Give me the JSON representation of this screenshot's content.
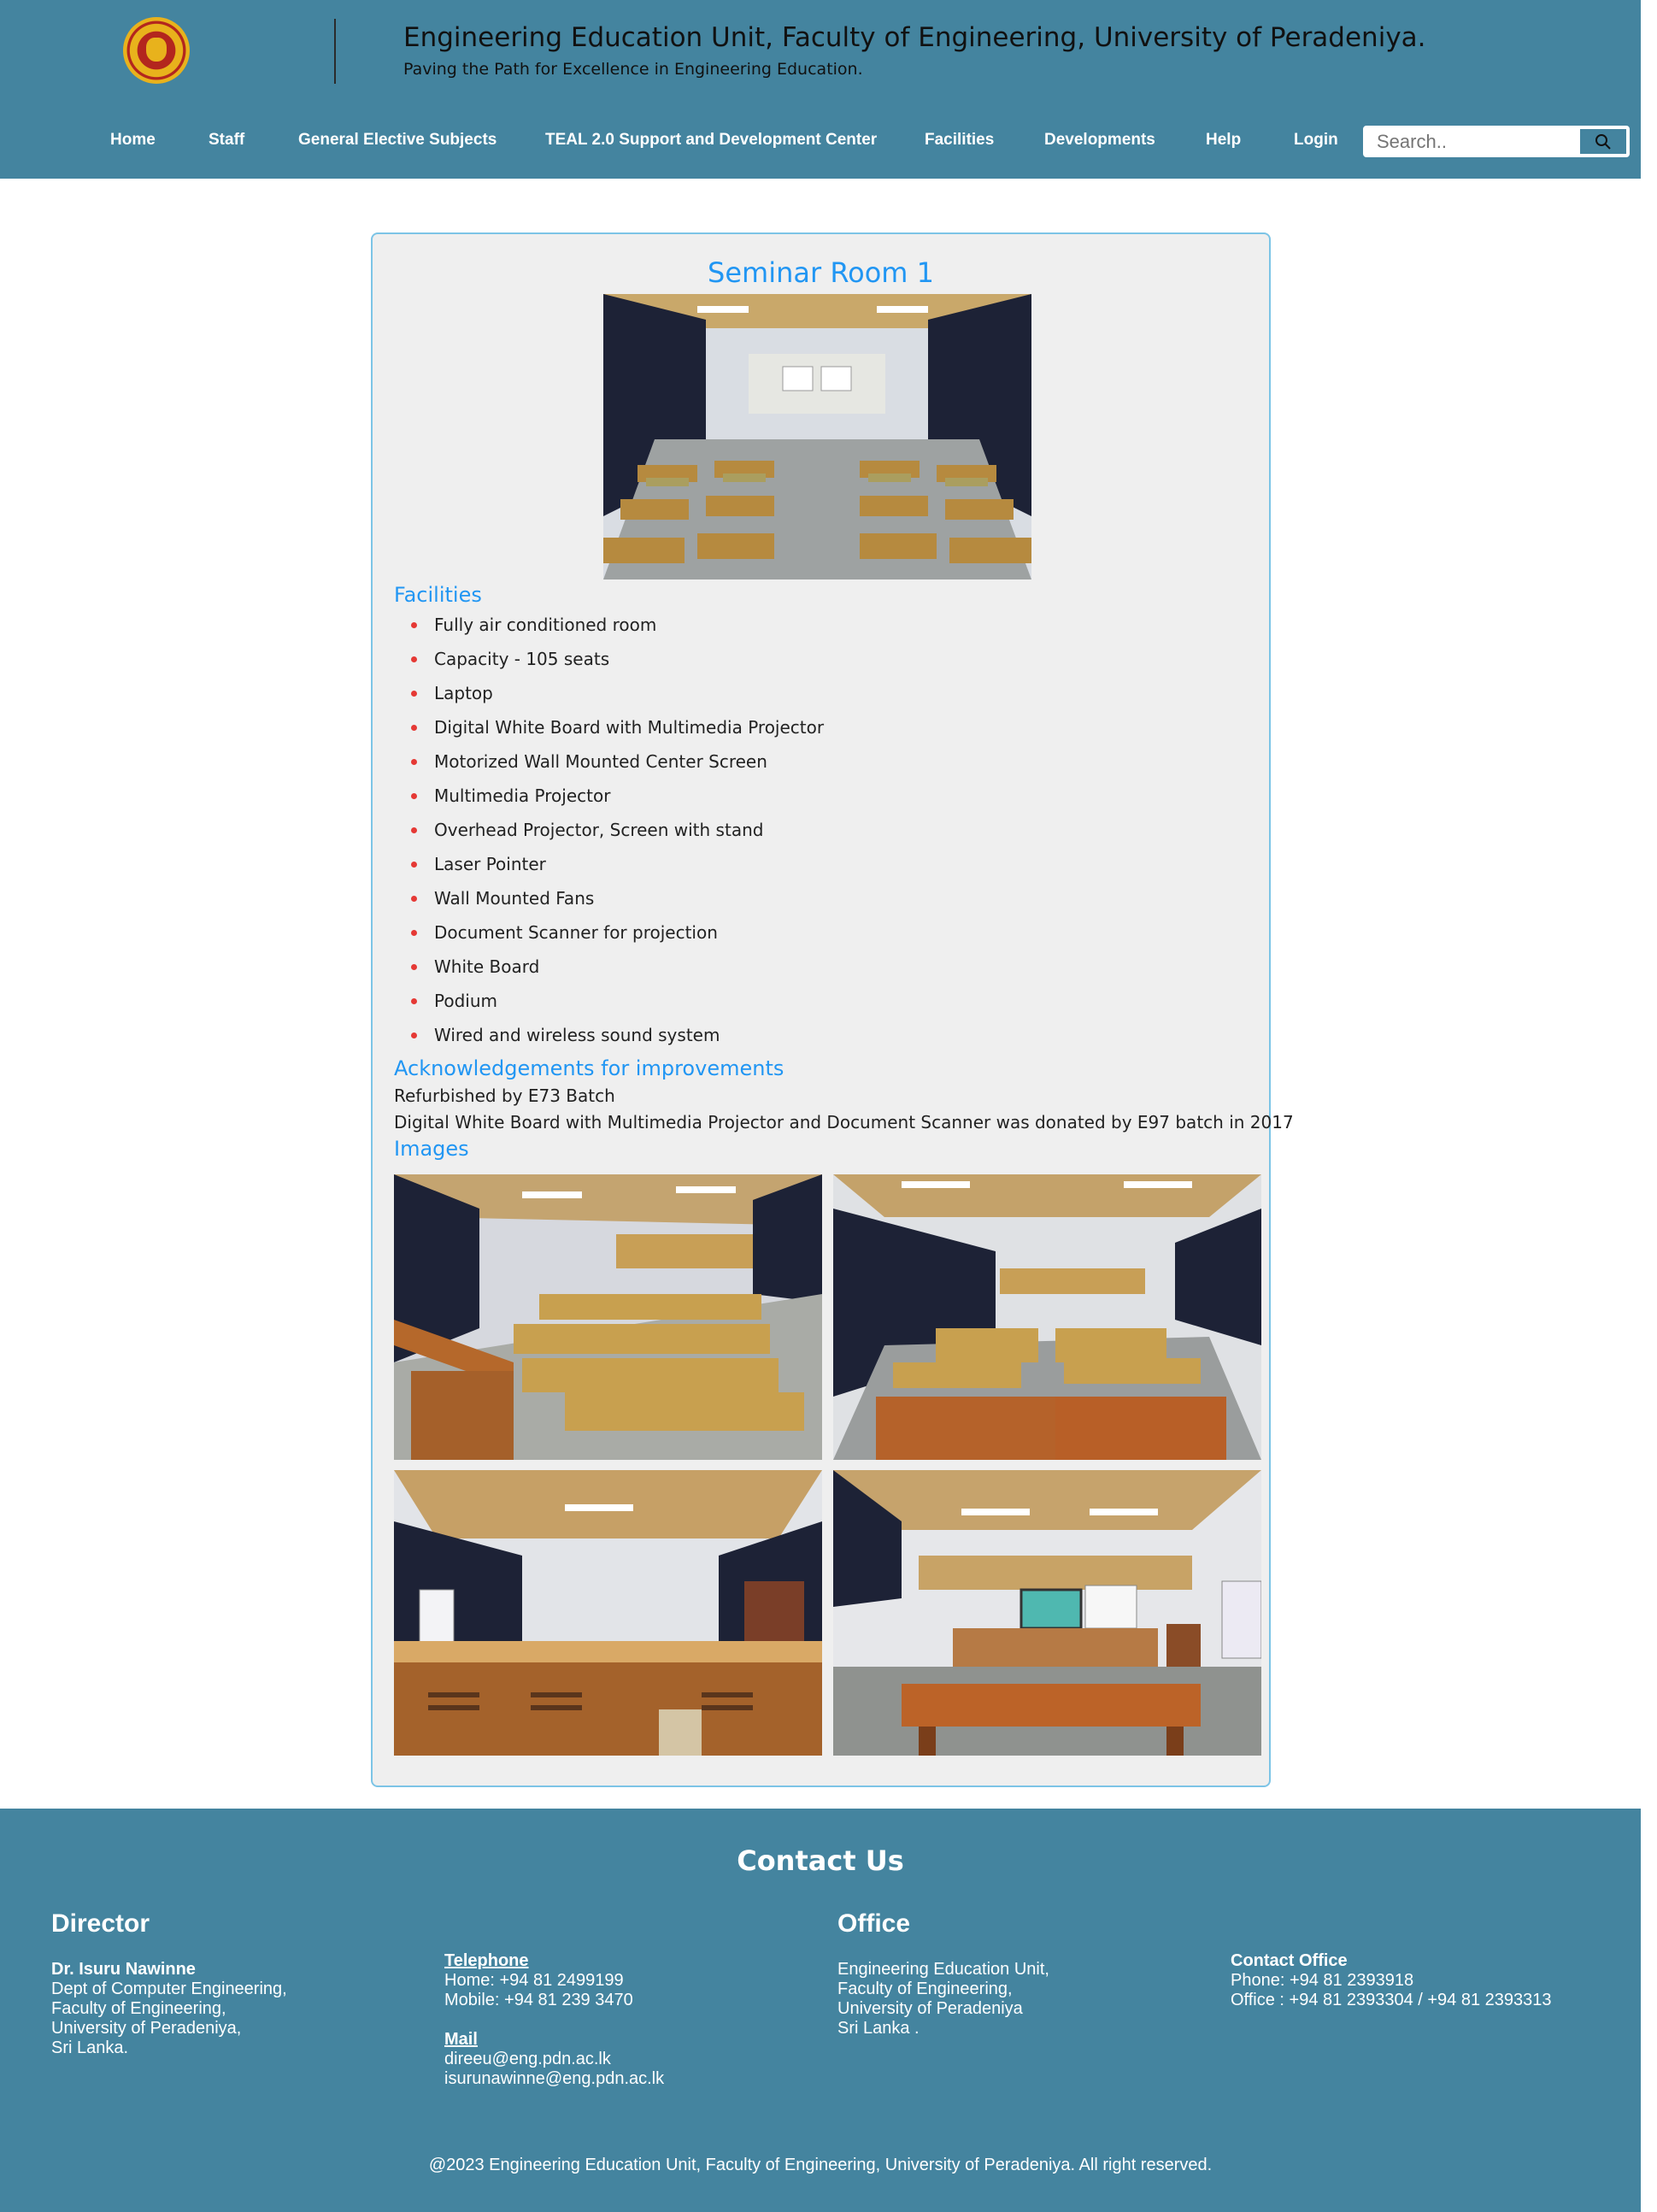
{
  "header": {
    "title": "Engineering Education Unit, Faculty of Engineering, University of Peradeniya.",
    "subtitle": "Paving the Path for Excellence in Engineering Education.",
    "logo_icon": "university-crest-icon",
    "colors": {
      "header_bg": "#44849f",
      "accent": "#2196f3",
      "bullet": "#e53935"
    }
  },
  "nav": {
    "items": [
      {
        "label": "Home"
      },
      {
        "label": "Staff"
      },
      {
        "label": "General Elective Subjects"
      },
      {
        "label": "TEAL 2.0 Support and Development Center"
      },
      {
        "label": "Facilities"
      },
      {
        "label": "Developments"
      },
      {
        "label": "Help"
      },
      {
        "label": "Login"
      }
    ],
    "search": {
      "placeholder": "Search..",
      "value": "",
      "button_icon": "search-icon"
    }
  },
  "room": {
    "title": "Seminar Room 1",
    "facilities_heading": "Facilities",
    "facilities": [
      "Fully air conditioned room",
      "Capacity - 105 seats",
      "Laptop",
      "Digital White Board with Multimedia Projector",
      "Motorized Wall Mounted Center Screen",
      "Multimedia Projector",
      "Overhead Projector, Screen with stand",
      "Laser Pointer",
      "Wall Mounted Fans",
      "Document Scanner for projection",
      "White Board",
      "Podium",
      "Wired and wireless sound system"
    ],
    "ack_heading": "Acknowledgements for improvements",
    "ack_lines": [
      "Refurbished by E73 Batch",
      "Digital White Board with Multimedia Projector and Document Scanner was donated by E97 batch in 2017"
    ],
    "images_heading": "Images"
  },
  "footer": {
    "title": "Contact Us",
    "director": {
      "heading": "Director",
      "name": "Dr. Isuru Nawinne",
      "lines": [
        "Dept of Computer Engineering,",
        "Faculty of Engineering,",
        "University of Peradeniya,",
        "Sri Lanka."
      ]
    },
    "telephone": {
      "heading": "Telephone",
      "home": "Home: +94 81 2499199",
      "mobile": "Mobile: +94 81 239 3470"
    },
    "mail": {
      "heading": "Mail",
      "emails": [
        "direeu@eng.pdn.ac.lk",
        "isurunawinne@eng.pdn.ac.lk"
      ]
    },
    "office": {
      "heading": "Office",
      "lines": [
        "Engineering Education Unit,",
        "Faculty of Engineering,",
        "University of Peradeniya",
        "Sri Lanka ."
      ]
    },
    "contact_office": {
      "heading": "Contact Office",
      "phone": "Phone: +94 81 2393918",
      "office": "Office : +94 81 2393304 / +94 81 2393313"
    },
    "copyright": "@2023 Engineering Education Unit, Faculty of Engineering, University of Peradeniya. All right reserved."
  }
}
